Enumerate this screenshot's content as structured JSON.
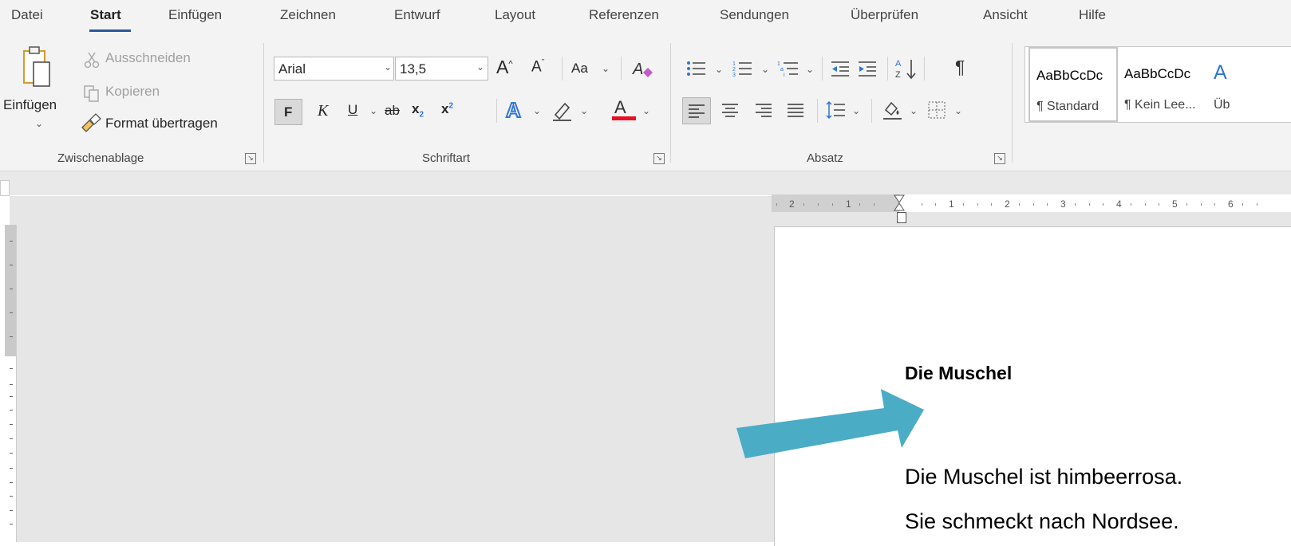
{
  "tabs": [
    {
      "label": "Datei"
    },
    {
      "label": "Start",
      "active": true
    },
    {
      "label": "Einfügen"
    },
    {
      "label": "Zeichnen"
    },
    {
      "label": "Entwurf"
    },
    {
      "label": "Layout"
    },
    {
      "label": "Referenzen"
    },
    {
      "label": "Sendungen"
    },
    {
      "label": "Überprüfen"
    },
    {
      "label": "Ansicht"
    },
    {
      "label": "Hilfe"
    }
  ],
  "clipboard": {
    "paste_label": "Einfügen",
    "cut_label": "Ausschneiden",
    "copy_label": "Kopieren",
    "format_painter_label": "Format übertragen",
    "group_label": "Zwischenablage"
  },
  "font": {
    "font_name": "Arial",
    "font_size": "13,5",
    "change_case_label": "Aa",
    "bold_label": "F",
    "italic_label": "K",
    "underline_label": "U",
    "strike_label": "ab",
    "subscript_label": "x",
    "superscript_label": "x",
    "group_label": "Schriftart",
    "font_color": "#e81123",
    "text_effect_color": "#2e75d6"
  },
  "paragraph": {
    "group_label": "Absatz",
    "pilcrow": "¶"
  },
  "styles": {
    "items": [
      {
        "sample": "AaBbCcDc",
        "name": "¶ Standard"
      },
      {
        "sample": "AaBbCcDc",
        "name": "¶ Kein Lee..."
      },
      {
        "sample": "A",
        "name": "Üb"
      }
    ]
  },
  "ruler": {
    "labels": [
      "2",
      "1",
      "1",
      "2",
      "3",
      "4",
      "5",
      "6"
    ]
  },
  "document": {
    "title": "Die Muschel",
    "lines": [
      "Die Muschel ist himbeerrosa.",
      "Sie schmeckt nach Nordsee."
    ]
  },
  "annotation": {
    "arrow_color": "#4bacc6"
  },
  "colors": {
    "accent": "#2b579a",
    "ribbon_bg": "#f3f3f3",
    "workspace_bg": "#e6e6e6"
  }
}
